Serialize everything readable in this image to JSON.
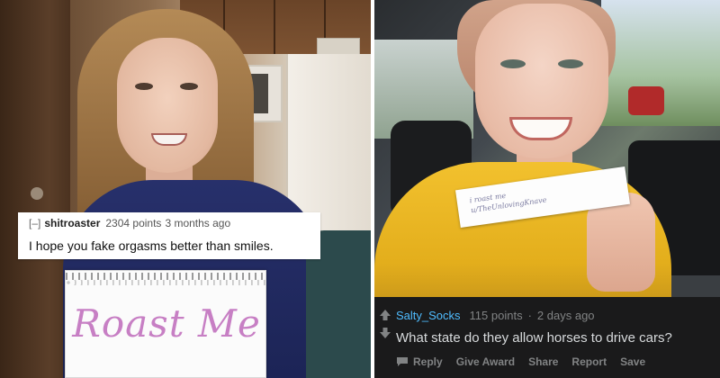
{
  "left_post": {
    "comment": {
      "toggle": "[–]",
      "author": "shitroaster",
      "points": "2304 points",
      "time": "3 months ago",
      "text": "I hope you fake orgasms better than smiles."
    },
    "sign_text": "Roast Me"
  },
  "right_post": {
    "note_lines": [
      "i roast me",
      "u/TheUnlovingKnave"
    ],
    "comment": {
      "author": "Salty_Socks",
      "points": "115 points",
      "separator": "·",
      "time": "2 days ago",
      "text": "What state do they allow horses to drive cars?"
    },
    "actions": {
      "reply": "Reply",
      "give_award": "Give Award",
      "share": "Share",
      "report": "Report",
      "save": "Save"
    }
  },
  "colors": {
    "reddit_bg": "#1a1a1b",
    "username_blue": "#4fbcff",
    "meta_gray": "#818384",
    "body_text": "#d7dadc",
    "sign_ink": "#c77fc4"
  },
  "icons": [
    "upvote-arrow-icon",
    "downvote-arrow-icon",
    "reply-bubble-icon"
  ]
}
